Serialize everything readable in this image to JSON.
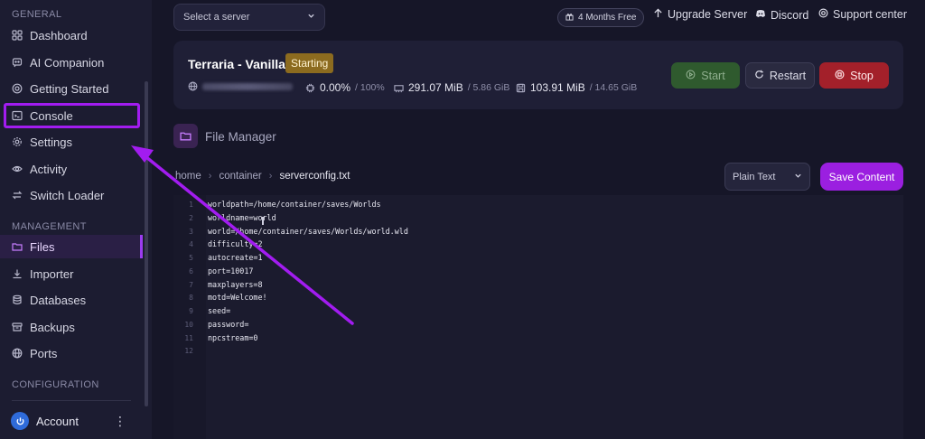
{
  "sidebar": {
    "sections": [
      {
        "label": "GENERAL"
      },
      {
        "label": "MANAGEMENT"
      },
      {
        "label": "CONFIGURATION"
      }
    ],
    "items": [
      {
        "label": "Dashboard",
        "icon": "dashboard-icon"
      },
      {
        "label": "AI Companion",
        "icon": "ai-companion-icon"
      },
      {
        "label": "Getting Started",
        "icon": "getting-started-icon"
      },
      {
        "label": "Console",
        "icon": "console-icon"
      },
      {
        "label": "Settings",
        "icon": "gear-icon"
      },
      {
        "label": "Activity",
        "icon": "eye-icon"
      },
      {
        "label": "Switch Loader",
        "icon": "switch-icon"
      },
      {
        "label": "Files",
        "icon": "folder-icon",
        "active": true
      },
      {
        "label": "Importer",
        "icon": "download-icon"
      },
      {
        "label": "Databases",
        "icon": "database-icon"
      },
      {
        "label": "Backups",
        "icon": "backup-icon"
      },
      {
        "label": "Ports",
        "icon": "globe-icon"
      }
    ],
    "account": {
      "label": "Account",
      "icon": "power-icon"
    }
  },
  "topbar": {
    "server_select_placeholder": "Select a server",
    "promo_label": "4 Months Free",
    "upgrade_label": "Upgrade Server",
    "discord_label": "Discord",
    "support_label": "Support center"
  },
  "server": {
    "name": "Terraria - Vanilla",
    "status": "Starting",
    "cpu": "0.00%",
    "cpu_limit": "/ 100%",
    "memory": "291.07 MiB",
    "memory_limit": "/ 5.86 GiB",
    "disk": "103.91 MiB",
    "disk_limit": "/ 14.65 GiB",
    "buttons": {
      "start": "Start",
      "restart": "Restart",
      "stop": "Stop"
    }
  },
  "file_manager": {
    "title": "File Manager",
    "breadcrumb": [
      "home",
      "container",
      "serverconfig.txt"
    ],
    "language": "Plain Text",
    "save_label": "Save Content",
    "lines": [
      "worldpath=/home/container/saves/Worlds",
      "worldname=world",
      "world=/home/container/saves/Worlds/world.wld",
      "difficulty=2",
      "autocreate=1",
      "port=10017",
      "maxplayers=8",
      "motd=Welcome!",
      "seed=",
      "password=",
      "npcstream=0",
      ""
    ],
    "line_numbers": [
      "1",
      "2",
      "3",
      "4",
      "5",
      "6",
      "7",
      "8",
      "9",
      "10",
      "11",
      "12"
    ]
  },
  "colors": {
    "accent": "#9b1fe0",
    "highlight_annotation": "#a21cf0",
    "status_starting": "#8c6b1f",
    "stop": "#a3202a",
    "start": "#2f5a2e"
  }
}
